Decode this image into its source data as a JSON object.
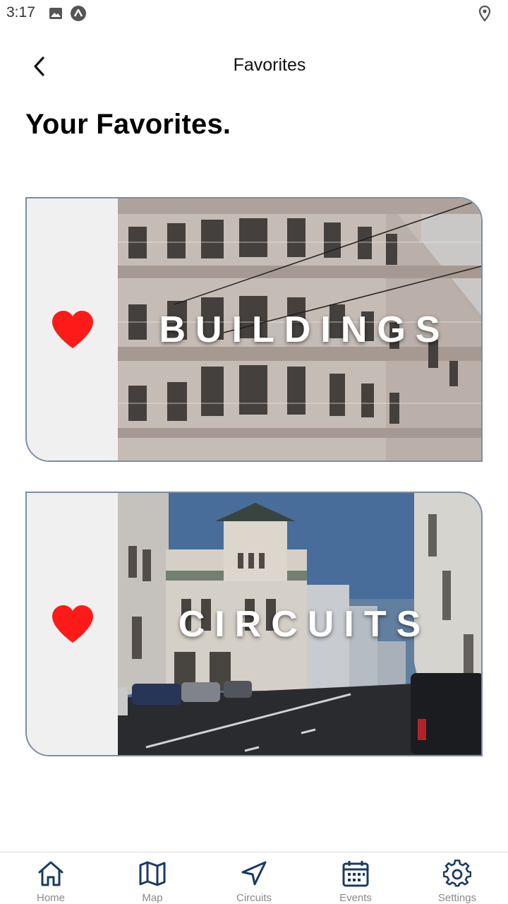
{
  "status_bar": {
    "time": "3:17",
    "icons": [
      "image-icon",
      "app-notification-icon",
      "location-pin-icon"
    ]
  },
  "header": {
    "back_icon": "chevron-left-icon",
    "title": "Favorites"
  },
  "page": {
    "heading": "Your Favorites."
  },
  "favorites": [
    {
      "label": "BUILDINGS",
      "icon": "heart-icon",
      "image": "ornate-colonial-building-photo"
    },
    {
      "label": "CIRCUITS",
      "icon": "heart-icon",
      "image": "city-street-with-clock-tower-photo"
    }
  ],
  "bottom_nav": {
    "items": [
      {
        "label": "Home",
        "icon": "home-icon"
      },
      {
        "label": "Map",
        "icon": "map-icon"
      },
      {
        "label": "Circuits",
        "icon": "navigation-arrow-icon"
      },
      {
        "label": "Events",
        "icon": "calendar-icon"
      },
      {
        "label": "Settings",
        "icon": "gear-icon"
      }
    ]
  },
  "colors": {
    "heart": "#ff1a1a",
    "nav_icon": "#1b3a63",
    "card_border": "#7b8ea3",
    "card_panel": "#f0f0f0",
    "nav_label": "#8a8a8a"
  }
}
